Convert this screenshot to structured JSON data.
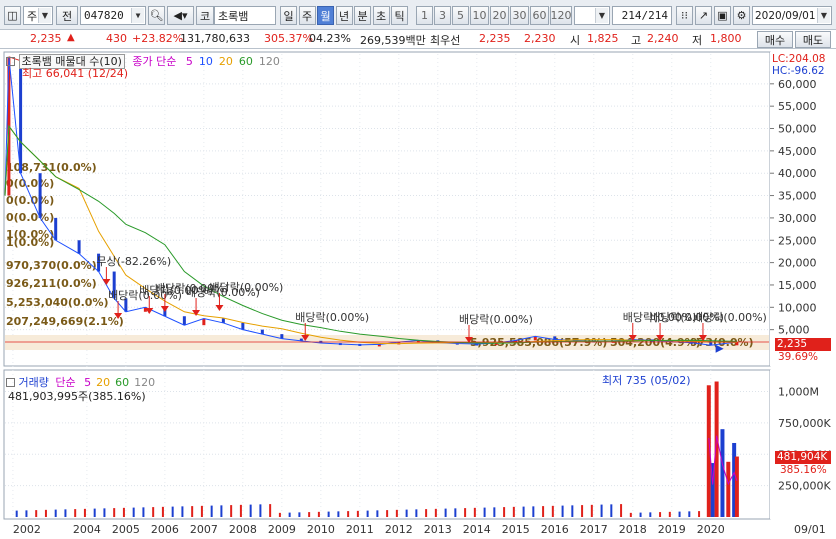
{
  "toolbar": {
    "period_mode": "주",
    "prev_label": "전",
    "stock_code": "047820",
    "stock_name": "초록뱀",
    "market_code": "코",
    "period_tabs": [
      "일",
      "주",
      "월",
      "년",
      "분",
      "초",
      "틱"
    ],
    "active_tab": "월",
    "intervals": [
      "1",
      "3",
      "5",
      "10",
      "20",
      "30",
      "60",
      "120"
    ],
    "count": "214",
    "count_total": "/214",
    "date": "2020/09/01"
  },
  "price_bar": {
    "price": "2,235",
    "change": "430",
    "change_pct": "+23.82%",
    "volume": "131,780,633",
    "volume_ratio": "305.37%",
    "turnover": "04.23%",
    "amount": "269,539백만",
    "best_bid_label": "최우선",
    "best_ask": "2,235",
    "best_bid": "2,230",
    "open_label": "시",
    "open": "1,825",
    "high_label": "고",
    "high": "2,240",
    "low_label": "저",
    "low": "1,800",
    "buy_button": "매수",
    "sell_button": "매도"
  },
  "colors": {
    "up": "#e0211b",
    "down": "#1c3fd0",
    "ma5": "#c800c8",
    "ma10": "#1e50ff",
    "ma20": "#e6a000",
    "ma60": "#2a9a2a",
    "ma120": "#888888"
  },
  "price_panel": {
    "title": "초록뱀 매물대 수(10)",
    "ma_type": "종가 단순",
    "ma_periods": [
      "5",
      "10",
      "20",
      "60",
      "120"
    ],
    "lc_label": "LC:204.08",
    "hc_label": "HC:-96.62",
    "high_marker": "최고 66,041 (12/24)",
    "low_marker": "최저 735 (05/02)",
    "current_price_tag": "2,235",
    "current_pct_tag": "39.69%",
    "y_ticks": [
      "60,000",
      "55,000",
      "50,000",
      "45,000",
      "40,000",
      "35,000",
      "30,000",
      "25,000",
      "20,000",
      "15,000",
      "10,000",
      "5,000"
    ],
    "volume_profile_labels": [
      "108,731(0.0%)",
      "0(0.0%)",
      "0(0.0%)",
      "0(0.0%)",
      "1(0.0%)",
      "1(0.0%)",
      "970,370(0.0%)",
      "926,211(0.0%)",
      "5,253,040(0.0%)",
      "207,249,669(2.1%)",
      "5,925,585,086(57.9%)",
      "504,200(4.9%)",
      "973(0.0%)"
    ],
    "event_labels": [
      "무상(-82.26%)",
      "배당락(0.00%)",
      "배당락(0.00%)",
      "배당락(0.00%)",
      "배당락(0.00%)",
      "배당락(0.00%)",
      "배당락(0.00%)",
      "배당락(0.00%)",
      "배당락(0.00%)",
      "배당락(0.00%)",
      "배당락(0.00%)"
    ]
  },
  "volume_panel": {
    "title": "거래량",
    "ma_type": "단순",
    "ma_periods": [
      "5",
      "20",
      "60",
      "120"
    ],
    "last_value": "481,903,995주(385.16%)",
    "value_tag": "481,904K",
    "pct_tag": "385.16%",
    "y_ticks": [
      "1,000M",
      "750,000K",
      "500,000K",
      "250,000K"
    ]
  },
  "x_axis": {
    "labels": [
      "2002",
      "2004",
      "2005",
      "2006",
      "2007",
      "2008",
      "2009",
      "2010",
      "2011",
      "2012",
      "2013",
      "2014",
      "2015",
      "2016",
      "2017",
      "2018",
      "2019",
      "2020"
    ],
    "right_label": "09/01"
  },
  "chart_data": {
    "type": "line",
    "series": [
      {
        "name": "초록뱀",
        "x": [
          2001.9,
          2002.0,
          2002.3,
          2002.8,
          2003.2,
          2003.8,
          2004.3,
          2004.7,
          2005.0,
          2005.5,
          2006.0,
          2006.5,
          2007.0,
          2007.5,
          2008.0,
          2008.5,
          2009.0,
          2009.5,
          2010.0,
          2010.5,
          2011.0,
          2011.5,
          2012.0,
          2012.5,
          2013.0,
          2013.5,
          2014.0,
          2014.5,
          2015.0,
          2015.5,
          2016.0,
          2016.5,
          2017.0,
          2017.5,
          2018.0,
          2018.5,
          2019.0,
          2019.5,
          2020.0,
          2020.67
        ],
        "y": [
          35000,
          66041,
          40000,
          30000,
          25000,
          22000,
          18000,
          12000,
          9000,
          10000,
          8000,
          6000,
          7500,
          6500,
          5000,
          4000,
          3000,
          2500,
          2000,
          1800,
          1600,
          1700,
          2200,
          2600,
          2100,
          1900,
          1800,
          2000,
          2600,
          3500,
          2800,
          2600,
          2400,
          2500,
          2800,
          2600,
          2300,
          2100,
          1500,
          2235
        ]
      }
    ],
    "volume": {
      "x": [
        2019.95,
        2020.05,
        2020.15,
        2020.3,
        2020.45,
        2020.6,
        2020.67
      ],
      "y": [
        1050000000,
        430000000,
        1080000000,
        700000000,
        440000000,
        590000000,
        481903995
      ]
    },
    "ylim": [
      0,
      66000
    ],
    "volume_ylim": [
      0,
      1100000000
    ],
    "high": {
      "value": 66041,
      "label": "12/24"
    },
    "low": {
      "value": 735,
      "label": "05/02"
    },
    "grid": true
  }
}
